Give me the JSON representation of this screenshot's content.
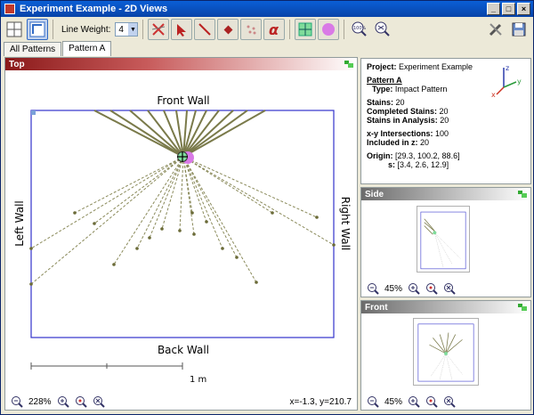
{
  "window": {
    "title": "Experiment Example - 2D Views"
  },
  "toolbar": {
    "line_weight_label": "Line Weight:",
    "line_weight_value": "4",
    "zoom_100_label": "100%"
  },
  "tabs": [
    {
      "label": "All Patterns",
      "active": false
    },
    {
      "label": "Pattern A",
      "active": true
    }
  ],
  "top_view": {
    "title": "Top",
    "walls": {
      "front": "Front Wall",
      "back": "Back Wall",
      "left": "Left Wall",
      "right": "Right Wall"
    },
    "scale_label": "1 m",
    "zoom": "228%",
    "coords": "x=-1.3, y=210.7"
  },
  "info": {
    "project_label": "Project:",
    "project_value": "Experiment Example",
    "pattern_name": "Pattern A",
    "type_label": "Type:",
    "type_value": "Impact Pattern",
    "stains_label": "Stains:",
    "stains_value": "20",
    "completed_label": "Completed Stains:",
    "completed_value": "20",
    "analysis_label": "Stains in Analysis:",
    "analysis_value": "20",
    "xy_label": "x-y Intersections:",
    "xy_value": "100",
    "included_label": "Included in z:",
    "included_value": "20",
    "origin_label": "Origin:",
    "origin_value": "[29.3, 100.2, 88.6]",
    "s_label": "s:",
    "s_value": "[3.4, 2.6, 12.9]",
    "axes": {
      "x": "x",
      "y": "y",
      "z": "z"
    }
  },
  "side_view": {
    "title": "Side",
    "zoom": "45%"
  },
  "front_view": {
    "title": "Front",
    "zoom": "45%"
  },
  "colors": {
    "accent": "#8b1a1a",
    "wall": "#3333cc",
    "string": "#7a7a4a"
  }
}
